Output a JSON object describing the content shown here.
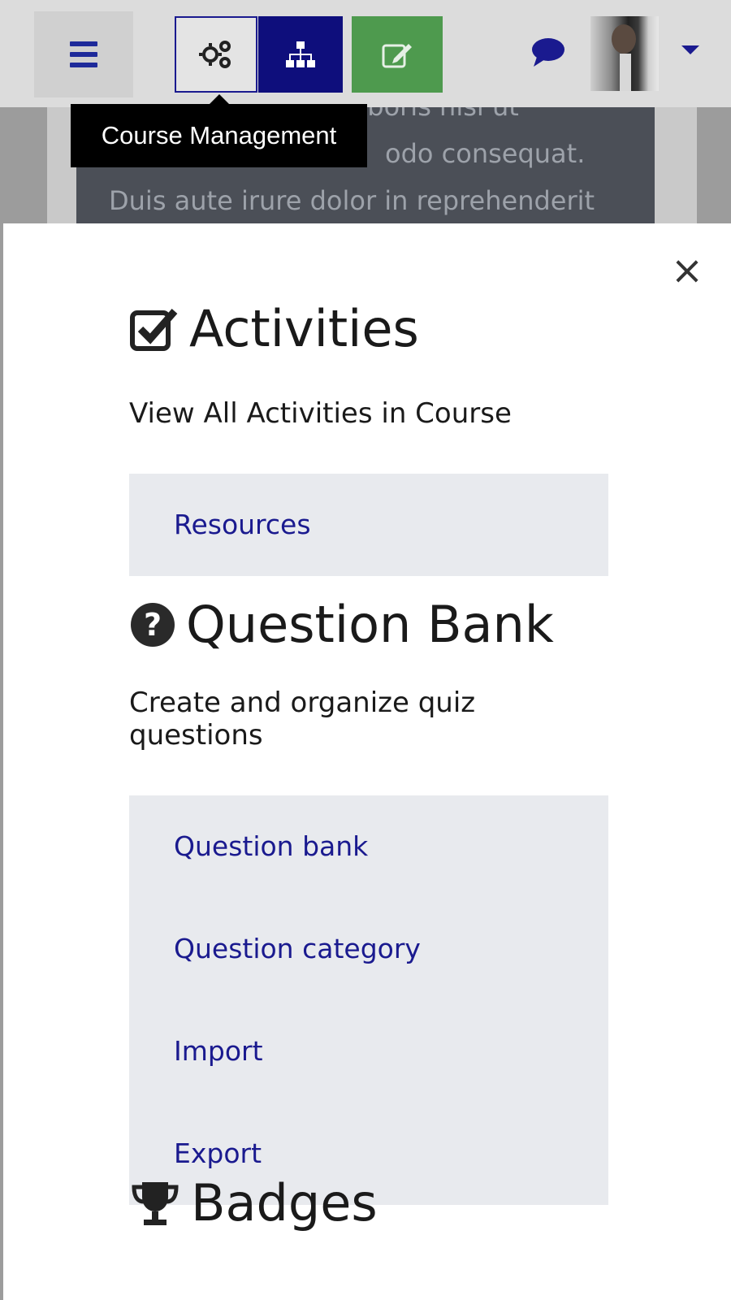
{
  "app": {
    "tooltip": "Course Management",
    "background_text": [
      "o laboris nisi ut",
      "odo consequat.",
      "Duis aute irure dolor in reprehenderit"
    ],
    "icons": {
      "menu": "hamburger-icon",
      "course_management": "gears-icon",
      "structure": "sitemap-icon",
      "edit": "edit-icon",
      "messages": "chat-icon",
      "user": "avatar",
      "user_menu": "caret-down-icon",
      "close": "close-icon"
    },
    "colors": {
      "link": "#1a1a8f",
      "edit_button": "#4e9a4e",
      "active_button": "#0e0e7c",
      "link_panel": "#e8eaee"
    }
  },
  "drawer": {
    "close_label": "×",
    "sections": [
      {
        "icon": "checkbox-icon",
        "title": "Activities",
        "description": "View All Activities in Course",
        "links": [
          "Resources"
        ]
      },
      {
        "icon": "question-circle-icon",
        "title": "Question Bank",
        "description": "Create and organize quiz questions",
        "links": [
          "Question bank",
          "Question category",
          "Import",
          "Export"
        ]
      },
      {
        "icon": "trophy-icon",
        "title": "Badges",
        "description": ""
      }
    ]
  }
}
